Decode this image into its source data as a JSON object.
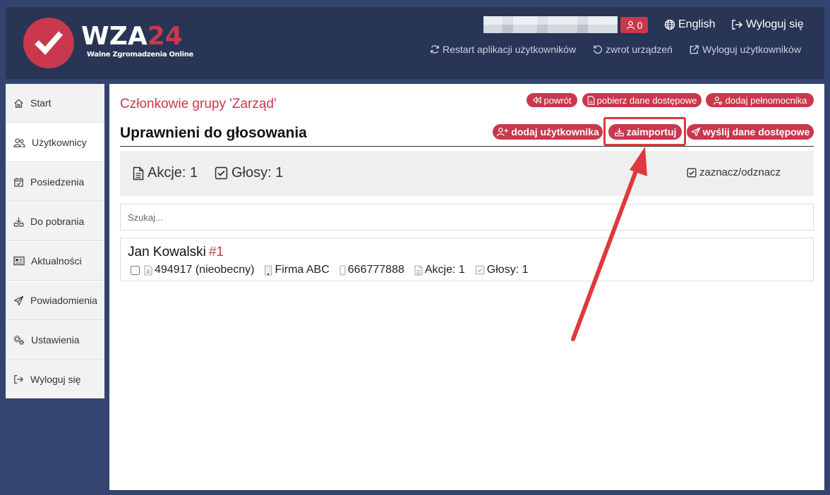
{
  "brand": {
    "logo_primary": "WZA",
    "logo_number": "24",
    "logo_subtitle": "Walne Zgromadzenia Online",
    "accent_color": "#c9384d",
    "header_color": "#283555",
    "background_color": "#344470"
  },
  "header": {
    "user_count": "0",
    "language_label": "English",
    "logout_label": "Wyloguj się",
    "restart_label": "Restart aplikacji użytkowników",
    "return_devices_label": "zwrot urządzeń",
    "logout_users_label": "Wyloguj użytkowników"
  },
  "sidebar": {
    "items": [
      {
        "label": "Start",
        "icon": "home-icon"
      },
      {
        "label": "Użytkownicy",
        "icon": "users-icon",
        "active": true
      },
      {
        "label": "Posiedzenia",
        "icon": "calendar-icon"
      },
      {
        "label": "Do pobrania",
        "icon": "download-icon"
      },
      {
        "label": "Aktualności",
        "icon": "news-icon"
      },
      {
        "label": "Powiadomienia",
        "icon": "paper-plane-icon"
      },
      {
        "label": "Ustawienia",
        "icon": "gears-icon"
      },
      {
        "label": "Wyloguj się",
        "icon": "logout-icon"
      }
    ]
  },
  "main": {
    "group_title": "Członkowie grupy 'Zarząd'",
    "section_title": "Uprawnieni do głosowania",
    "buttons": {
      "back": "powrót",
      "download_access": "pobierz dane dostępowe",
      "add_proxy": "dodaj pełnomocnika",
      "add_user": "dodaj użytkownika",
      "import": "zaimportuj",
      "send_access": "wyślij dane dostępowe"
    },
    "stats": {
      "shares": "Akcje: 1",
      "votes": "Głosy: 1",
      "toggle_all": "zaznacz/odznacz"
    },
    "search": {
      "placeholder": "Szukaj..."
    },
    "users": [
      {
        "name": "Jan Kowalski",
        "number": "#1",
        "id_status": "494917 (nieobecny)",
        "company": "Firma ABC",
        "phone": "666777888",
        "shares": "Akcje: 1",
        "votes": "Głosy: 1"
      }
    ]
  },
  "annotation": {
    "highlight_color": "#e0383e"
  }
}
